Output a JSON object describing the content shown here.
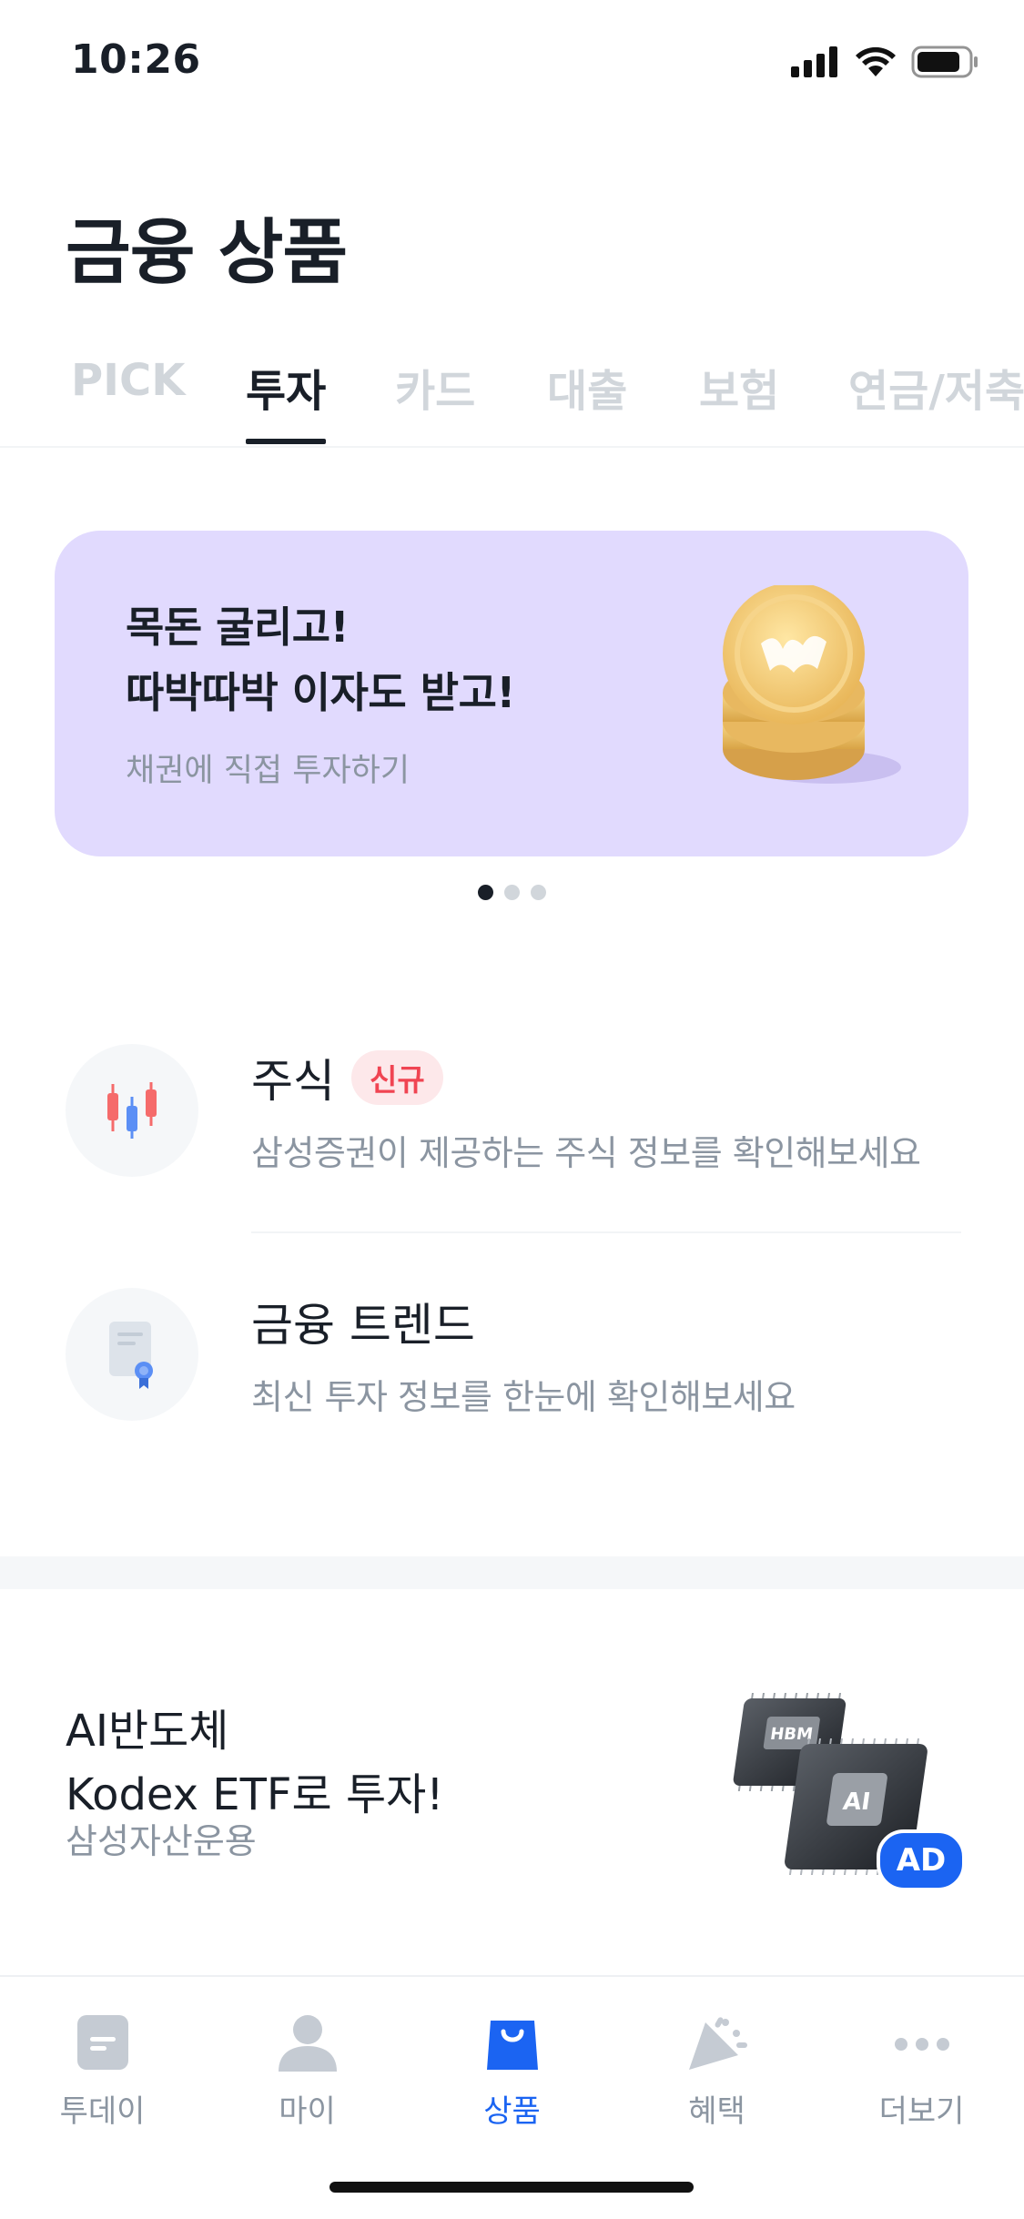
{
  "status_bar": {
    "time": "10:26"
  },
  "page": {
    "title": "금융 상품"
  },
  "tabs": [
    {
      "label": "PICK"
    },
    {
      "label": "투자"
    },
    {
      "label": "카드"
    },
    {
      "label": "대출"
    },
    {
      "label": "보험"
    },
    {
      "label": "연금/저축"
    }
  ],
  "active_tab": "투자",
  "banner": {
    "line1": "목돈 굴리고!",
    "line2": "따박따박 이자도 받고!",
    "subtitle": "채권에 직접 투자하기",
    "background": "#e1dafe",
    "page_index": 1,
    "page_count": 3
  },
  "list": [
    {
      "title": "주식",
      "badge": "신규",
      "subtitle": "삼성증권이 제공하는 주식 정보를 확인해보세요",
      "icon": "candlestick-chart-icon"
    },
    {
      "title": "금융 트렌드",
      "subtitle": "최신 투자 정보를 한눈에 확인해보세요",
      "icon": "document-certificate-icon"
    }
  ],
  "ad": {
    "line1": "AI반도체",
    "line2": "Kodex ETF로 투자!",
    "sponsor": "삼성자산운용",
    "chip1_label": "HBM",
    "chip2_label": "AI",
    "badge": "AD"
  },
  "bottom_nav": [
    {
      "label": "투데이",
      "icon": "today-icon"
    },
    {
      "label": "마이",
      "icon": "person-icon"
    },
    {
      "label": "상품",
      "icon": "shopping-bag-icon"
    },
    {
      "label": "혜택",
      "icon": "party-popper-icon"
    },
    {
      "label": "더보기",
      "icon": "more-dots-icon"
    }
  ],
  "active_nav": "상품",
  "colors": {
    "accent": "#1b64f2",
    "new_badge": "#f04452",
    "text_primary": "#191f28",
    "text_secondary": "#8b95a1"
  }
}
